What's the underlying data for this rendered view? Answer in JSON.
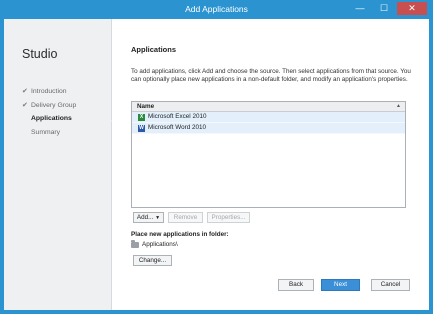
{
  "window": {
    "title": "Add Applications",
    "controls": {
      "minimize": "—",
      "maximize": "☐",
      "close": "✕"
    }
  },
  "sidebar": {
    "title": "Studio",
    "items": [
      {
        "label": "Introduction",
        "state": "done"
      },
      {
        "label": "Delivery Group",
        "state": "done"
      },
      {
        "label": "Applications",
        "state": "active"
      },
      {
        "label": "Summary",
        "state": "pending"
      }
    ],
    "check_glyph": "✔"
  },
  "main": {
    "heading": "Applications",
    "description": "To add applications, click Add and choose the source. Then select applications from that source. You can optionally place new applications in a non-default folder, and modify an application's properties.",
    "list": {
      "column_header": "Name",
      "rows": [
        {
          "label": "Microsoft Excel 2010",
          "icon": "excel-icon",
          "icon_letter": "X"
        },
        {
          "label": "Microsoft Word 2010",
          "icon": "word-icon",
          "icon_letter": "W"
        }
      ]
    },
    "list_buttons": {
      "add": "Add...",
      "remove": "Remove",
      "properties": "Properties..."
    },
    "folder": {
      "label": "Place new applications in folder:",
      "path": "Applications\\",
      "change_button": "Change..."
    }
  },
  "footer": {
    "back": "Back",
    "next": "Next",
    "cancel": "Cancel"
  },
  "colors": {
    "title_bar": "#2a93d0",
    "accent_button": "#3a8fd6",
    "selected_row": "#e3f0fb"
  }
}
